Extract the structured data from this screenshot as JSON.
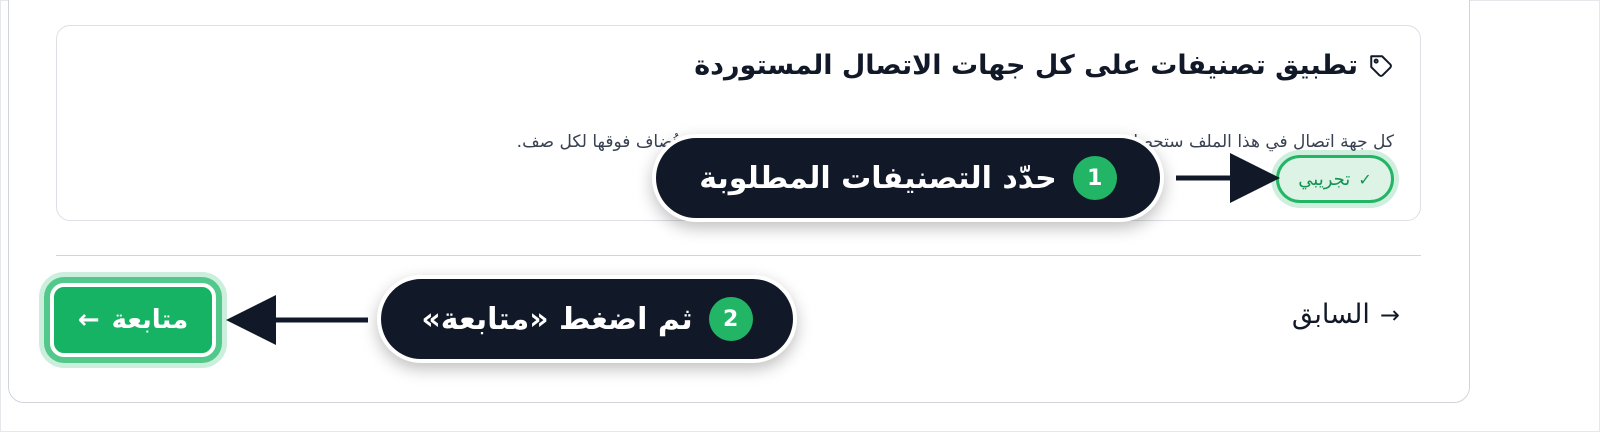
{
  "tags_section": {
    "title": "تطبيق تصنيفات على كل جهات الاتصال المستوردة",
    "description": "كل جهة اتصال في هذا الملف ستحصل على هذه التصنيفات. التصنيفات الواردة من عمود «التصنيفات» تُضاف فوقها لكل صف.",
    "tag_label": "تجريبي",
    "tag_selected": true,
    "icon": "tag-icon"
  },
  "footer": {
    "prev_label": "السابق",
    "next_label": "متابعة"
  },
  "annotations": [
    {
      "number": "1",
      "text": "حدّد التصنيفات المطلوبة"
    },
    {
      "number": "2",
      "text": "ثم اضغط «متابعة»"
    }
  ],
  "colors": {
    "accent": "#16b364",
    "callout_bg": "#111827",
    "chip_bg": "#dcf3e6"
  }
}
